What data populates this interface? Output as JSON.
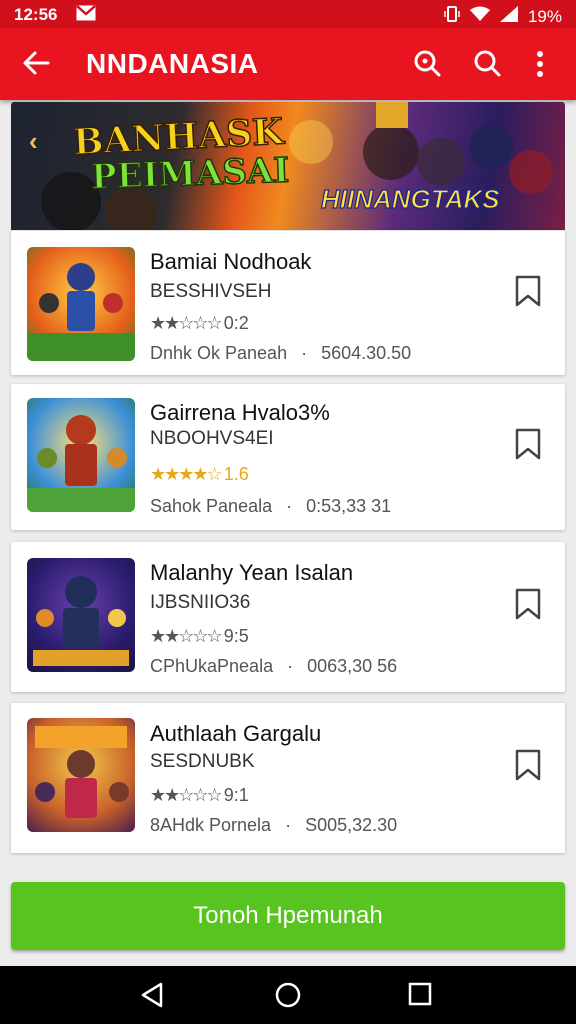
{
  "status": {
    "time": "12:56",
    "battery": "19%"
  },
  "appbar": {
    "title": "NNDANASIA"
  },
  "banner": {
    "line1": "BANHASK",
    "line2": "PEIMASAI",
    "line3": "HIINANGTAKS"
  },
  "items": [
    {
      "name": "Bamiai Nodhoak",
      "developer": "BESSHIVSEH",
      "stars": "★★☆☆☆",
      "rating": "0:2",
      "category": "Dnhk Ok Paneah",
      "size": "5604.30.50",
      "star_color": "#555555"
    },
    {
      "name": "Gairrena Hvalo3%",
      "developer": "NBOOHVS4EI",
      "stars": "★★★★☆",
      "rating": "1.6",
      "category": "Sahok Paneala",
      "size": "0:53,33 31",
      "star_color": "#e6a817"
    },
    {
      "name": "Malanhy Yean Isalan",
      "developer": "IJBSNIIO36",
      "stars": "★★☆☆☆",
      "rating": "9:5",
      "category": "CPhUkaPneala",
      "size": "0063,30 56",
      "star_color": "#555555"
    },
    {
      "name": "Authlaah Gargalu",
      "developer": "SESDNUBK",
      "stars": "★★☆☆☆",
      "rating": "9:1",
      "category": "8AHdk Pornela",
      "size": "S005,32.30",
      "star_color": "#555555"
    }
  ],
  "cta": {
    "label": "Tonoh Hpemunah"
  },
  "colors": {
    "primary": "#e8141f",
    "cta": "#58c41f"
  }
}
